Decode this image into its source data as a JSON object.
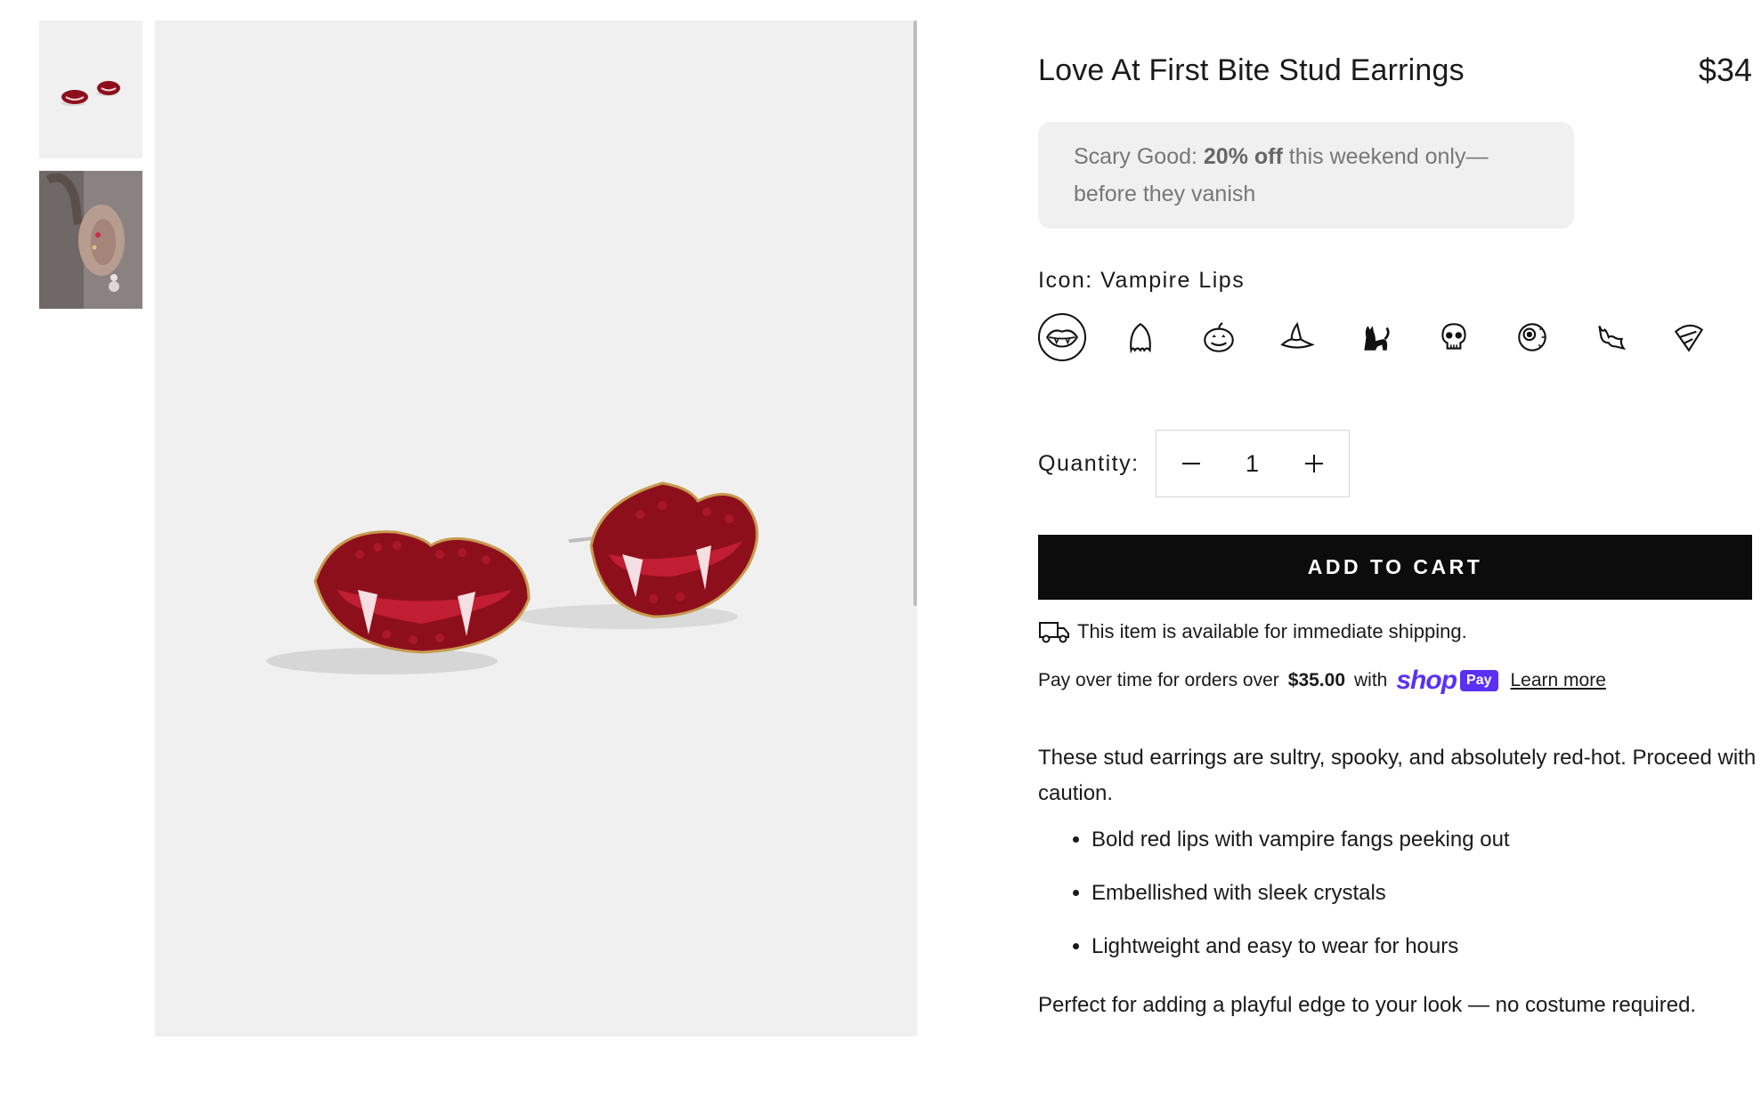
{
  "gallery": {
    "thumbnails": [
      {
        "alt": "earrings-product-shot"
      },
      {
        "alt": "earrings-worn-on-ear"
      }
    ]
  },
  "product": {
    "title": "Love At First Bite Stud Earrings",
    "price": "$34",
    "promo": {
      "prefix": "Scary Good: ",
      "highlight": "20% off",
      "suffix": " this weekend only—before they vanish"
    },
    "icon_option": {
      "label": "Icon:",
      "selected": "Vampire Lips",
      "options": [
        "Vampire Lips",
        "Ghost",
        "Pumpkin",
        "Witch Hat",
        "Black Cat",
        "Skull",
        "Eyeball",
        "Bat",
        "Candy Corn"
      ]
    },
    "quantity": {
      "label": "Quantity:",
      "value": "1"
    },
    "add_to_cart": "ADD TO CART",
    "shipping_note": "This item is available for immediate shipping.",
    "shop_pay": {
      "prefix": "Pay over time for orders over",
      "amount": "$35.00",
      "with": "with",
      "shop_word": "shop",
      "pay_word": "Pay",
      "learn_more": "Learn more"
    },
    "description": "These stud earrings are sultry, spooky, and absolutely red-hot. Proceed with caution.",
    "bullets": [
      "Bold red lips with vampire fangs peeking out",
      "Embellished with sleek crystals",
      "Lightweight and easy to wear for hours"
    ],
    "closing": "Perfect for adding a playful edge to your look — no costume required."
  },
  "colors": {
    "accent": "#5a31f4",
    "button": "#0c0c0c",
    "earring_red": "#8e0f1c",
    "image_bg": "#f0f0f0"
  }
}
